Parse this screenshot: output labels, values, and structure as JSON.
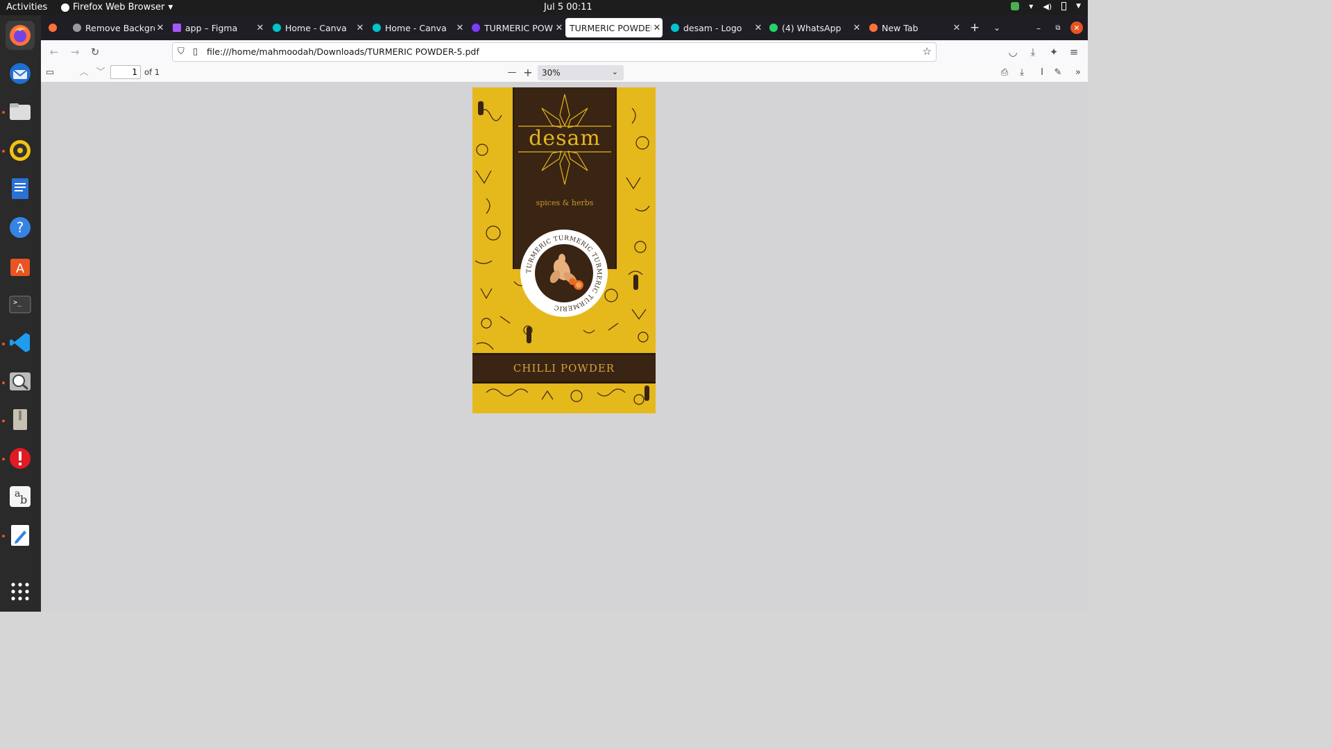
{
  "system": {
    "activities": "Activities",
    "app_menu": "Firefox Web Browser",
    "clock": "Jul 5  00:11"
  },
  "tabs": [
    {
      "title": "Remove Backgrou",
      "icon": "removebg-icon",
      "color": "#9a9a9a"
    },
    {
      "title": "app – Figma",
      "icon": "figma-icon",
      "color": "#a259ff"
    },
    {
      "title": "Home - Canva",
      "icon": "canva-icon",
      "color": "#00c4cc"
    },
    {
      "title": "Home - Canva",
      "icon": "canva-icon",
      "color": "#00c4cc"
    },
    {
      "title": "TURMERIC POWD",
      "icon": "canva-heart-icon",
      "color": "#7d3cff"
    },
    {
      "title": "TURMERIC POWDER",
      "icon": "pdf-icon",
      "color": "#ffffff",
      "active": true
    },
    {
      "title": "desam - Logo",
      "icon": "canva-icon",
      "color": "#00c4cc"
    },
    {
      "title": "(4) WhatsApp",
      "icon": "whatsapp-icon",
      "color": "#25d366"
    },
    {
      "title": "New Tab",
      "icon": "firefox-icon",
      "color": "#ff7139"
    }
  ],
  "navigation": {
    "url": "file:///home/mahmoodah/Downloads/TURMERIC POWDER-5.pdf"
  },
  "pdf_toolbar": {
    "page_number": "1",
    "page_count": "of 1",
    "zoom": "30%"
  },
  "document": {
    "brand": "desam",
    "tagline": "spices & herbs",
    "ring_text": "TURMERIC TURMERIC TURMERIC TURMERIC",
    "product_name": "CHILLI  POWDER"
  },
  "colors": {
    "label_yellow": "#e5b81c",
    "label_brown": "#3a2414",
    "accent_orange": "#e95420"
  }
}
